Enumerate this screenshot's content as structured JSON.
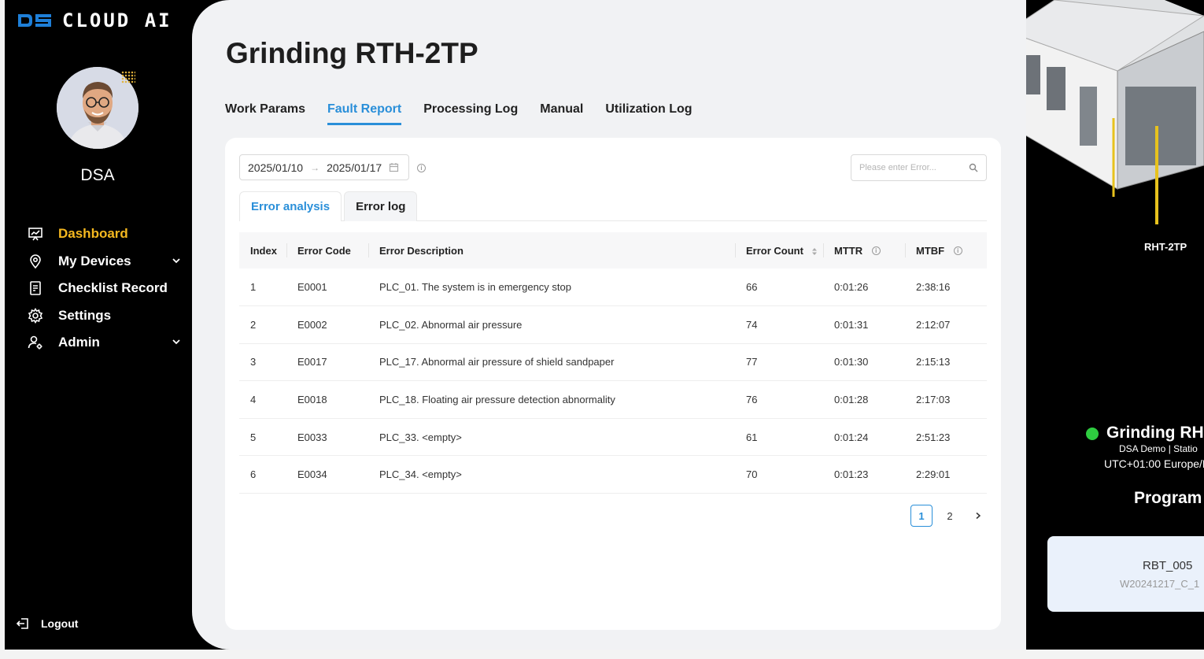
{
  "app": {
    "logo_text": "CLOUD AI"
  },
  "user": {
    "name": "DSA"
  },
  "sidebar": {
    "items": [
      {
        "label": "Dashboard",
        "icon": "presentation-chart-icon",
        "active": true
      },
      {
        "label": "My Devices",
        "icon": "location-pin-icon",
        "has_children": true
      },
      {
        "label": "Checklist Record",
        "icon": "clipboard-icon"
      },
      {
        "label": "Settings",
        "icon": "gear-icon"
      },
      {
        "label": "Admin",
        "icon": "user-cog-icon",
        "has_children": true
      }
    ],
    "logout_label": "Logout"
  },
  "page": {
    "title": "Grinding RTH-2TP"
  },
  "tabs": [
    {
      "label": "Work Params"
    },
    {
      "label": "Fault Report",
      "active": true
    },
    {
      "label": "Processing Log"
    },
    {
      "label": "Manual"
    },
    {
      "label": "Utilization Log"
    }
  ],
  "filters": {
    "date_start": "2025/01/10",
    "date_end": "2025/01/17",
    "search_placeholder": "Please enter Error..."
  },
  "subtabs": [
    {
      "label": "Error analysis",
      "active": true
    },
    {
      "label": "Error log"
    }
  ],
  "table": {
    "columns": [
      "Index",
      "Error Code",
      "Error Description",
      "Error Count",
      "MTTR",
      "MTBF"
    ],
    "rows": [
      {
        "index": "1",
        "code": "E0001",
        "description": "PLC_01. The system is in emergency stop",
        "count": "66",
        "mttr": "0:01:26",
        "mtbf": "2:38:16"
      },
      {
        "index": "2",
        "code": "E0002",
        "description": "PLC_02. Abnormal air pressure",
        "count": "74",
        "mttr": "0:01:31",
        "mtbf": "2:12:07"
      },
      {
        "index": "3",
        "code": "E0017",
        "description": "PLC_17. Abnormal air pressure of shield sandpaper",
        "count": "77",
        "mttr": "0:01:30",
        "mtbf": "2:15:13"
      },
      {
        "index": "4",
        "code": "E0018",
        "description": "PLC_18. Floating air pressure detection abnormality",
        "count": "76",
        "mttr": "0:01:28",
        "mtbf": "2:17:03"
      },
      {
        "index": "5",
        "code": "E0033",
        "description": "PLC_33. <empty>",
        "count": "61",
        "mttr": "0:01:24",
        "mtbf": "2:51:23"
      },
      {
        "index": "6",
        "code": "E0034",
        "description": "PLC_34. <empty>",
        "count": "70",
        "mttr": "0:01:23",
        "mtbf": "2:29:01"
      }
    ]
  },
  "pagination": {
    "pages": [
      "1",
      "2"
    ],
    "current": "1"
  },
  "right_panel": {
    "machine_label": "RHT-2TP",
    "device_name": "Grinding RH",
    "device_sub": "DSA Demo | Statio",
    "timezone": "UTC+01:00 Europe/E",
    "program_label": "Program",
    "program_name": "RBT_005",
    "program_file": "W20241217_C_1",
    "status_color": "#2ecc40"
  },
  "colors": {
    "accent": "#2a8fd9",
    "active_nav": "#f5b81f",
    "logo_blue": "#1e7fd8"
  }
}
